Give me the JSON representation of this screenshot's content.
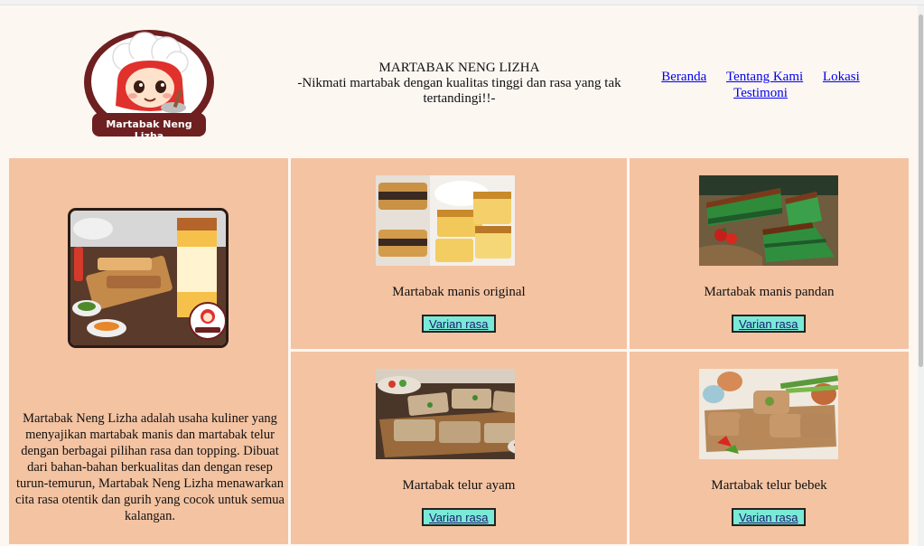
{
  "header": {
    "brand_name": "MARTABAK NENG LIZHA",
    "tagline": "-Nikmati martabak dengan kualitas tinggi dan rasa yang tak tertandingi!!-",
    "logo_text": "Martabak Neng Lizha"
  },
  "nav": {
    "items": [
      "Beranda",
      "Tentang Kami",
      "Lokasi",
      "Testimoni"
    ]
  },
  "about": {
    "text": "Martabak Neng Lizha adalah usaha kuliner yang menyajikan martabak manis dan martabak telur dengan berbagai pilihan rasa dan topping. Dibuat dari bahan-bahan berkualitas dan dengan resep turun-temurun, Martabak Neng Lizha menawarkan cita rasa otentik dan gurih yang cocok untuk semua kalangan."
  },
  "products": [
    {
      "name": "Martabak manis original",
      "button": "Varian rasa"
    },
    {
      "name": "Martabak manis pandan",
      "button": "Varian rasa"
    },
    {
      "name": "Martabak telur ayam",
      "button": "Varian rasa"
    },
    {
      "name": "Martabak telur bebek",
      "button": "Varian rasa"
    }
  ],
  "colors": {
    "page_bg": "#fdf7f2",
    "cell_bg": "#f4c3a2",
    "button_bg": "#79ead6",
    "link": "#0000ee",
    "logo_maroon": "#6e1f1f"
  }
}
